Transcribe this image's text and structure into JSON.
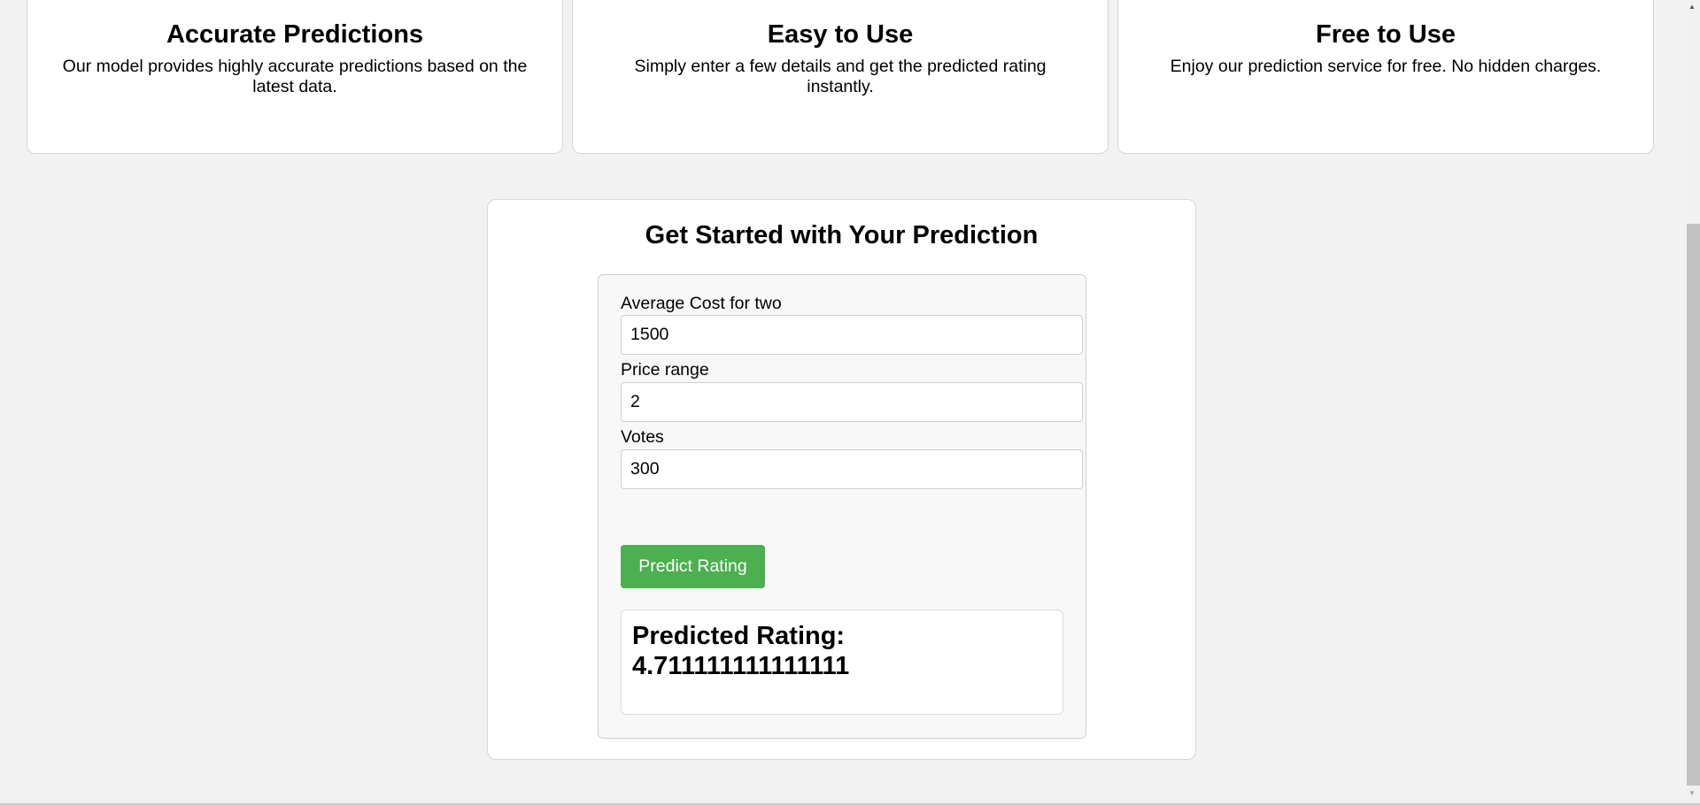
{
  "features": [
    {
      "title": "Accurate Predictions",
      "text": "Our model provides highly accurate predictions based on the latest data."
    },
    {
      "title": "Easy to Use",
      "text": "Simply enter a few details and get the predicted rating instantly."
    },
    {
      "title": "Free to Use",
      "text": "Enjoy our prediction service for free. No hidden charges."
    }
  ],
  "prediction": {
    "title": "Get Started with Your Prediction",
    "fields": [
      {
        "label": "Average Cost for two",
        "value": "1500"
      },
      {
        "label": "Price range",
        "value": "2"
      },
      {
        "label": "Votes",
        "value": "300"
      }
    ],
    "button": "Predict Rating",
    "result_label": "Predicted Rating:",
    "result_value": "4.711111111111111"
  },
  "colors": {
    "button": "#4caf50",
    "background": "#f2f2f2"
  }
}
